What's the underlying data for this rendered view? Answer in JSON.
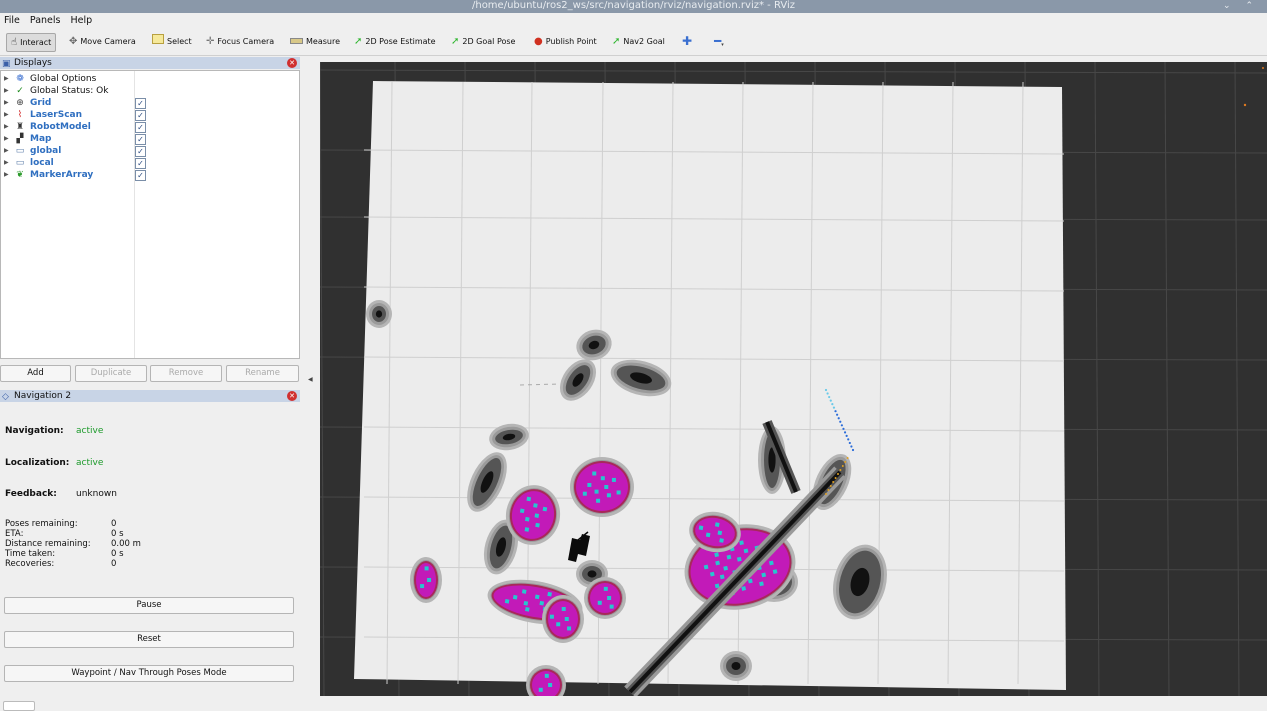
{
  "window": {
    "title": "/home/ubuntu/ros2_ws/src/navigation/rviz/navigation.rviz* - RViz",
    "controls": "⌄ ⌃"
  },
  "menu": {
    "items": [
      "File",
      "Panels",
      "Help"
    ]
  },
  "toolbar": {
    "tools": [
      {
        "label": "Interact",
        "icon": "cursor-icon"
      },
      {
        "label": "Move Camera",
        "icon": "move-camera-icon"
      },
      {
        "label": "Select",
        "icon": "select-icon"
      },
      {
        "label": "Focus Camera",
        "icon": "focus-camera-icon"
      },
      {
        "label": "Measure",
        "icon": "ruler-icon"
      },
      {
        "label": "2D Pose Estimate",
        "icon": "green-arrow-icon"
      },
      {
        "label": "2D Goal Pose",
        "icon": "green-arrow-icon"
      },
      {
        "label": "Publish Point",
        "icon": "map-pin-icon"
      },
      {
        "label": "Nav2 Goal",
        "icon": "green-arrow-icon"
      }
    ],
    "add_tool_icon": "plus-icon",
    "remove_tool_icon": "minus-icon"
  },
  "displays_panel": {
    "title": "Displays",
    "items": [
      {
        "label": "Global Options",
        "icon": "gear-icon",
        "checkable": false
      },
      {
        "label": "Global Status: Ok",
        "icon": "checkmark-icon",
        "checkable": false
      },
      {
        "label": "Grid",
        "icon": "grid-icon",
        "checkable": true,
        "checked": true
      },
      {
        "label": "LaserScan",
        "icon": "laserscan-icon",
        "checkable": true,
        "checked": true
      },
      {
        "label": "RobotModel",
        "icon": "robot-icon",
        "checkable": true,
        "checked": true
      },
      {
        "label": "Map",
        "icon": "map-icon",
        "checkable": true,
        "checked": true
      },
      {
        "label": "global",
        "icon": "folder-icon",
        "checkable": true,
        "checked": true
      },
      {
        "label": "local",
        "icon": "folder-icon",
        "checkable": true,
        "checked": true
      },
      {
        "label": "MarkerArray",
        "icon": "marker-icon",
        "checkable": true,
        "checked": true
      }
    ],
    "buttons": {
      "add": "Add",
      "duplicate": "Duplicate",
      "remove": "Remove",
      "rename": "Rename"
    }
  },
  "nav2_panel": {
    "title": "Navigation 2",
    "navigation_label": "Navigation:",
    "navigation_value": "active",
    "localization_label": "Localization:",
    "localization_value": "active",
    "feedback_label": "Feedback:",
    "feedback_value": "unknown",
    "stats": [
      {
        "label": "Poses remaining:",
        "value": "0"
      },
      {
        "label": "ETA:",
        "value": "0 s"
      },
      {
        "label": "Distance remaining:",
        "value": "0.00 m"
      },
      {
        "label": "Time taken:",
        "value": "0 s"
      },
      {
        "label": "Recoveries:",
        "value": "0"
      }
    ],
    "pause_label": "Pause",
    "reset_label": "Reset",
    "waypoint_label": "Waypoint / Nav Through Poses Mode"
  },
  "colors": {
    "viewport_bg": "#303030",
    "map_free": "#ececec",
    "obstacle": "#111111",
    "inflation_dark": "#555555",
    "inflation_light": "#9a9a9a",
    "costmap_magenta": "#c21ab8",
    "costmap_cyan": "#27c6cf",
    "costmap_rim": "#a8285a",
    "status_active": "#1c9a2a",
    "display_label_blue": "#2f6fc0"
  }
}
